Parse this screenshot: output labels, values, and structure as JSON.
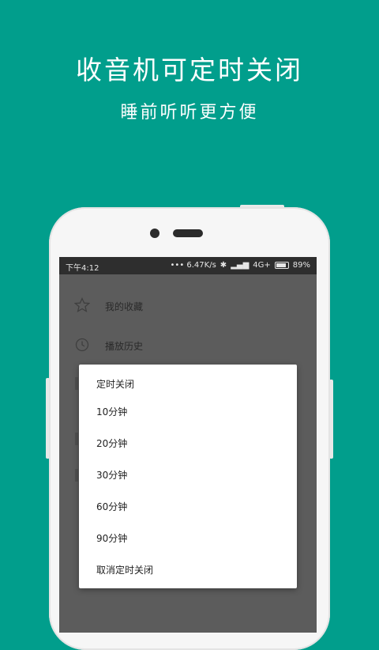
{
  "headline": "收音机可定时关闭",
  "subline": "睡前听听更方便",
  "status_bar": {
    "time": "下午4:12",
    "speed": "••• 6.47K/s",
    "network": "4G+",
    "battery": "89%"
  },
  "menu": {
    "items": [
      {
        "label": "我的收藏",
        "icon": "star-icon"
      },
      {
        "label": "播放历史",
        "icon": "history-icon"
      }
    ]
  },
  "dialog": {
    "title": "定时关闭",
    "options": [
      "10分钟",
      "20分钟",
      "30分钟",
      "60分钟",
      "90分钟",
      "取消定时关闭"
    ]
  },
  "colors": {
    "background": "#019e8c",
    "dim_overlay": "#5c5c5c"
  }
}
